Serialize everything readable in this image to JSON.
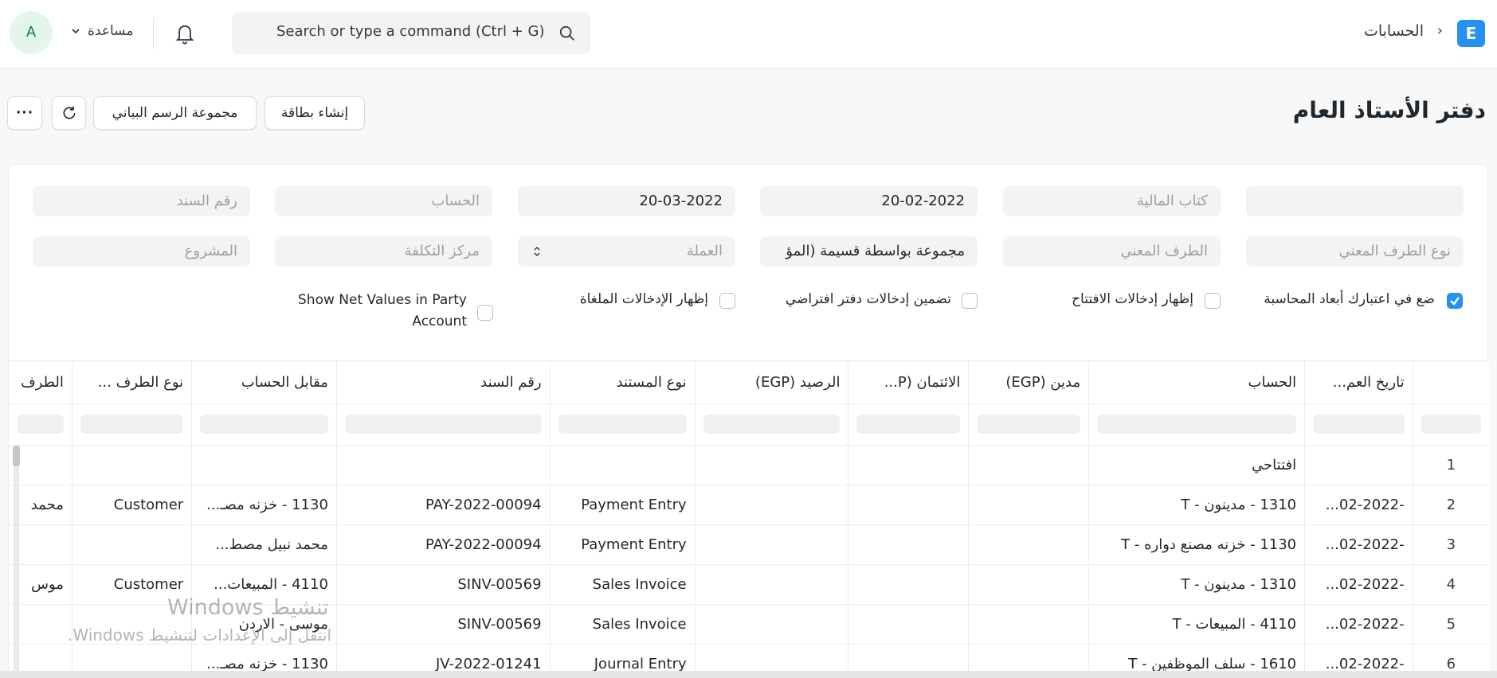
{
  "navbar": {
    "logo_letter": "E",
    "breadcrumb": "الحسابات",
    "breadcrumb_sep": "›",
    "search_placeholder": "Search or type a command (Ctrl + G)",
    "help_label": "مساعدة",
    "avatar_letter": "A",
    "accent_color": "#2490ef"
  },
  "page": {
    "title": "دفتر الأستاذ العام",
    "buttons": {
      "create_card": "إنشاء بطاقة",
      "chart_group": "مجموعة الرسم البياني",
      "more": "···"
    }
  },
  "filters": {
    "company": "",
    "finance_book": "كتاب المالية",
    "from_date": "20-02-2022",
    "to_date": "20-03-2022",
    "account": "الحساب",
    "voucher_no": "رقم السند",
    "party_type": "نوع الطرف المعني",
    "party": "الطرف المعني",
    "group_by": "مجموعة بواسطة قسيمة (المؤ",
    "currency": "العملة",
    "cost_center": "مركز التكلفة",
    "project": "المشروع"
  },
  "checkboxes": {
    "consider_dimensions": {
      "label": "ضع في اعتبارك أبعاد المحاسبة",
      "checked": true
    },
    "show_opening": {
      "label": "إظهار إدخالات الافتتاح",
      "checked": false
    },
    "include_default_book": {
      "label": "تضمين إدخالات دفتر افتراضي",
      "checked": false
    },
    "show_cancelled": {
      "label": "إظهار الإدخالات الملغاة",
      "checked": false
    },
    "show_net_values": {
      "label": "Show Net Values in Party Account",
      "checked": false
    }
  },
  "table": {
    "columns": [
      "",
      "تاريخ العم...",
      "الحساب",
      "مدين (EGP)",
      "الائتمان (P...",
      "الرصيد (EGP)",
      "نوع المستند",
      "رقم السند",
      "مقابل الحساب",
      "نوع الطرف ...",
      "الطرف"
    ],
    "rows": [
      {
        "no": "1",
        "date": "",
        "account": "افتتاحي",
        "debit": "",
        "credit": "",
        "balance": "",
        "doc_type": "",
        "voucher": "",
        "against": "",
        "party_type": "",
        "party": ""
      },
      {
        "no": "2",
        "date": "...02-2022-",
        "account": "1310 - مدينون - T",
        "debit": "",
        "credit": "",
        "balance": "",
        "doc_type": "Payment Entry",
        "voucher": "PAY-2022-00094",
        "against": "1130 - خزنه مصـ...",
        "party_type": "Customer",
        "party": "محمد"
      },
      {
        "no": "3",
        "date": "...02-2022-",
        "account": "1130 - خزنه مصنع دواره - T",
        "debit": "",
        "credit": "",
        "balance": "",
        "doc_type": "Payment Entry",
        "voucher": "PAY-2022-00094",
        "against": "محمد نبيل مصط...",
        "party_type": "",
        "party": ""
      },
      {
        "no": "4",
        "date": "...02-2022-",
        "account": "1310 - مدينون - T",
        "debit": "",
        "credit": "",
        "balance": "",
        "doc_type": "Sales Invoice",
        "voucher": "SINV-00569",
        "against": "4110 - المبيعات...",
        "party_type": "Customer",
        "party": "موس"
      },
      {
        "no": "5",
        "date": "...02-2022-",
        "account": "4110 - المبيعات - T",
        "debit": "",
        "credit": "",
        "balance": "",
        "doc_type": "Sales Invoice",
        "voucher": "SINV-00569",
        "against": "موسى - الاردن",
        "party_type": "",
        "party": ""
      },
      {
        "no": "6",
        "date": "...02-2022-",
        "account": "1610 - سلف الموظفين - T",
        "debit": "",
        "credit": "",
        "balance": "",
        "doc_type": "Journal Entry",
        "voucher": "JV-2022-01241",
        "against": "1130 - خزنه مصـ...",
        "party_type": "",
        "party": ""
      }
    ]
  },
  "watermark": {
    "line1": "تنشيط Windows",
    "line2": "انتقل إلى الإعدادات لتنشيط Windows."
  }
}
